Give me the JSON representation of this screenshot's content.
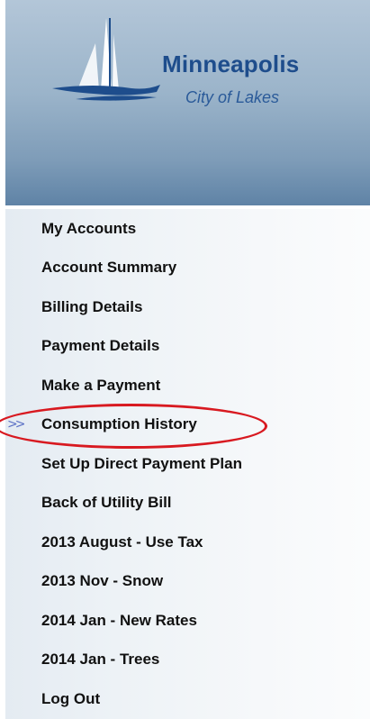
{
  "header": {
    "logo_title": "Minneapolis",
    "logo_subtitle": "City of Lakes"
  },
  "nav": {
    "items": [
      {
        "label": "My Accounts"
      },
      {
        "label": "Account Summary"
      },
      {
        "label": "Billing Details"
      },
      {
        "label": "Payment Details"
      },
      {
        "label": "Make a Payment"
      },
      {
        "label": "Consumption History",
        "active": true
      },
      {
        "label": "Set Up Direct Payment Plan"
      },
      {
        "label": "Back of Utility Bill"
      },
      {
        "label": "2013 August - Use Tax"
      },
      {
        "label": "2013 Nov - Snow"
      },
      {
        "label": "2014 Jan - New Rates"
      },
      {
        "label": "2014 Jan - Trees"
      },
      {
        "label": "Log Out"
      }
    ],
    "active_indicator_icon": "double-chevron-right-icon",
    "annotation_color": "#d81920"
  }
}
